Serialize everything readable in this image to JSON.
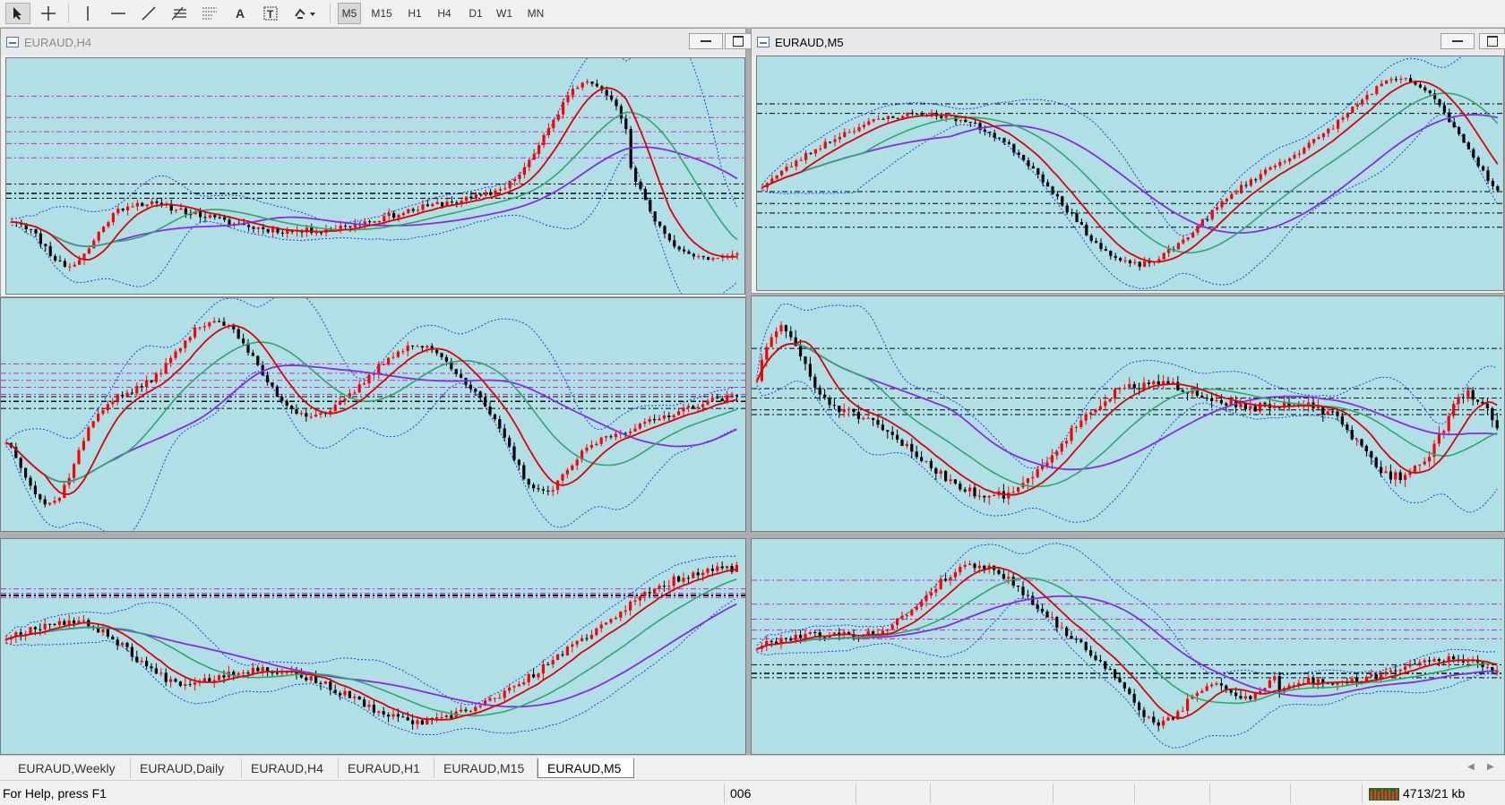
{
  "toolbar": {
    "icons": [
      "cursor-icon",
      "crosshair-icon",
      "vertical-line-icon",
      "horizontal-line-icon",
      "trendline-icon",
      "fibonacci-icon",
      "grid-fibo-icon",
      "text-icon",
      "text-label-icon",
      "shapes-menu-icon"
    ],
    "timeframes": [
      "M5",
      "M15",
      "H1",
      "H4",
      "D1",
      "W1",
      "MN"
    ],
    "active_timeframe": "M5"
  },
  "windows": {
    "h4_title": "EURAUD,H4",
    "m5_title": "EURAUD,M5"
  },
  "tabs": [
    "EURAUD,Weekly",
    "EURAUD,Daily",
    "EURAUD,H4",
    "EURAUD,H1",
    "EURAUD,M15",
    "EURAUD,M5"
  ],
  "active_tab": "EURAUD,M5",
  "status": {
    "help": "For Help, press F1",
    "profile": "006",
    "traffic": "4713/21 kb"
  },
  "colors": {
    "chart_background": "#b0e0e6",
    "bull_candle": "#ff0000",
    "bear_candle": "#000000",
    "ma_fast": "#e00000",
    "ma_mid": "#2ea86a",
    "ma_slow": "#8a2be2",
    "bollinger": "#1f3fe0",
    "level_magenta": "#d020d0",
    "level_black": "#000000"
  }
}
